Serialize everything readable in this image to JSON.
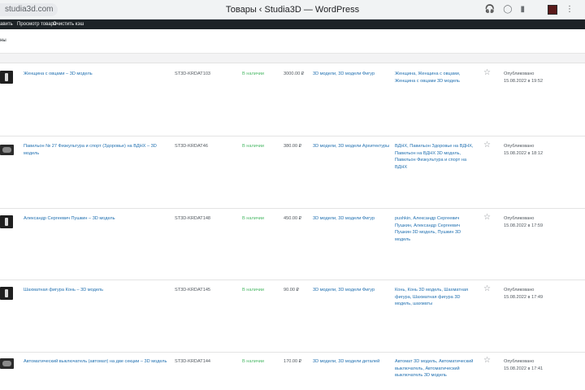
{
  "browser": {
    "url": "studia3d.com",
    "window_title": "Товары ‹ Studia3D — WordPress",
    "icons": [
      "headphones-icon",
      "chat-icon",
      "bookmark-icon"
    ],
    "menu_glyph": "⋮"
  },
  "admin_bar": {
    "links": [
      "авить",
      "Просмотр товара",
      "Очистить кэш"
    ]
  },
  "toolbar": {
    "text": "ны"
  },
  "products": [
    {
      "thumb": "figure",
      "name": "Женщина с овцами – 3D модель",
      "sku": "ST3D-KRDAT103",
      "stock": "В наличии",
      "price": "3000.00 ₽",
      "categories": "3D модели, 3D модели Фигур",
      "tags": "Женщина, Женщина с овцами, Женщина с овцами 3D модель",
      "status": "Опубликовано",
      "date": "15.08.2022 в 19:52"
    },
    {
      "thumb": "building",
      "name": "Павильон № 27 Физкультура и спорт (Здоровье) на ВДНХ – 3D модель",
      "sku": "ST3D-KRDAT46",
      "stock": "В наличии",
      "price": "380.00 ₽",
      "categories": "3D модели, 3D модели Архитектуры",
      "tags": "ВДНХ, Павильон Здоровье на ВДНХ, Павильон на ВДНХ 3D модель, Павильон Физкультура и спорт на ВДНХ",
      "status": "Опубликовано",
      "date": "15.08.2022 в 18:12"
    },
    {
      "thumb": "figure",
      "name": "Александр Сергеевич Пушкин – 3D модель",
      "sku": "ST3D-KRDAT148",
      "stock": "В наличии",
      "price": "450.00 ₽",
      "categories": "3D модели, 3D модели Фигур",
      "tags": "pushkin, Александр Сергеевич Пушкин, Александр Сергеевич Пушкин 3D модель, Пушкин 3D модель",
      "status": "Опубликовано",
      "date": "15.08.2022 в 17:59"
    },
    {
      "thumb": "figure",
      "name": "Шахматная фигура Конь – 3D модель",
      "sku": "ST3D-KRDAT145",
      "stock": "В наличии",
      "price": "90.00 ₽",
      "categories": "3D модели, 3D модели Фигур",
      "tags": "Конь, Конь 3D модель, Шахматная фигура, Шахматная фигура 3D модель, шахматы",
      "status": "Опубликовано",
      "date": "15.08.2022 в 17:49"
    },
    {
      "thumb": "building",
      "name": "Автоматический выключатель (автомат) на две секции – 3D модель",
      "sku": "ST3D-KRDAT144",
      "stock": "В наличии",
      "price": "170.00 ₽",
      "categories": "3D модели, 3D модели деталей",
      "tags": "Автомат 3D модель, Автоматический выключатель, Автоматический выключатель 3D модель",
      "status": "Опубликовано",
      "date": "15.08.2022 в 17:41"
    }
  ],
  "colors": {
    "admin_bar": "#1d2327",
    "link": "#2271b1",
    "in_stock": "#4ab866"
  }
}
